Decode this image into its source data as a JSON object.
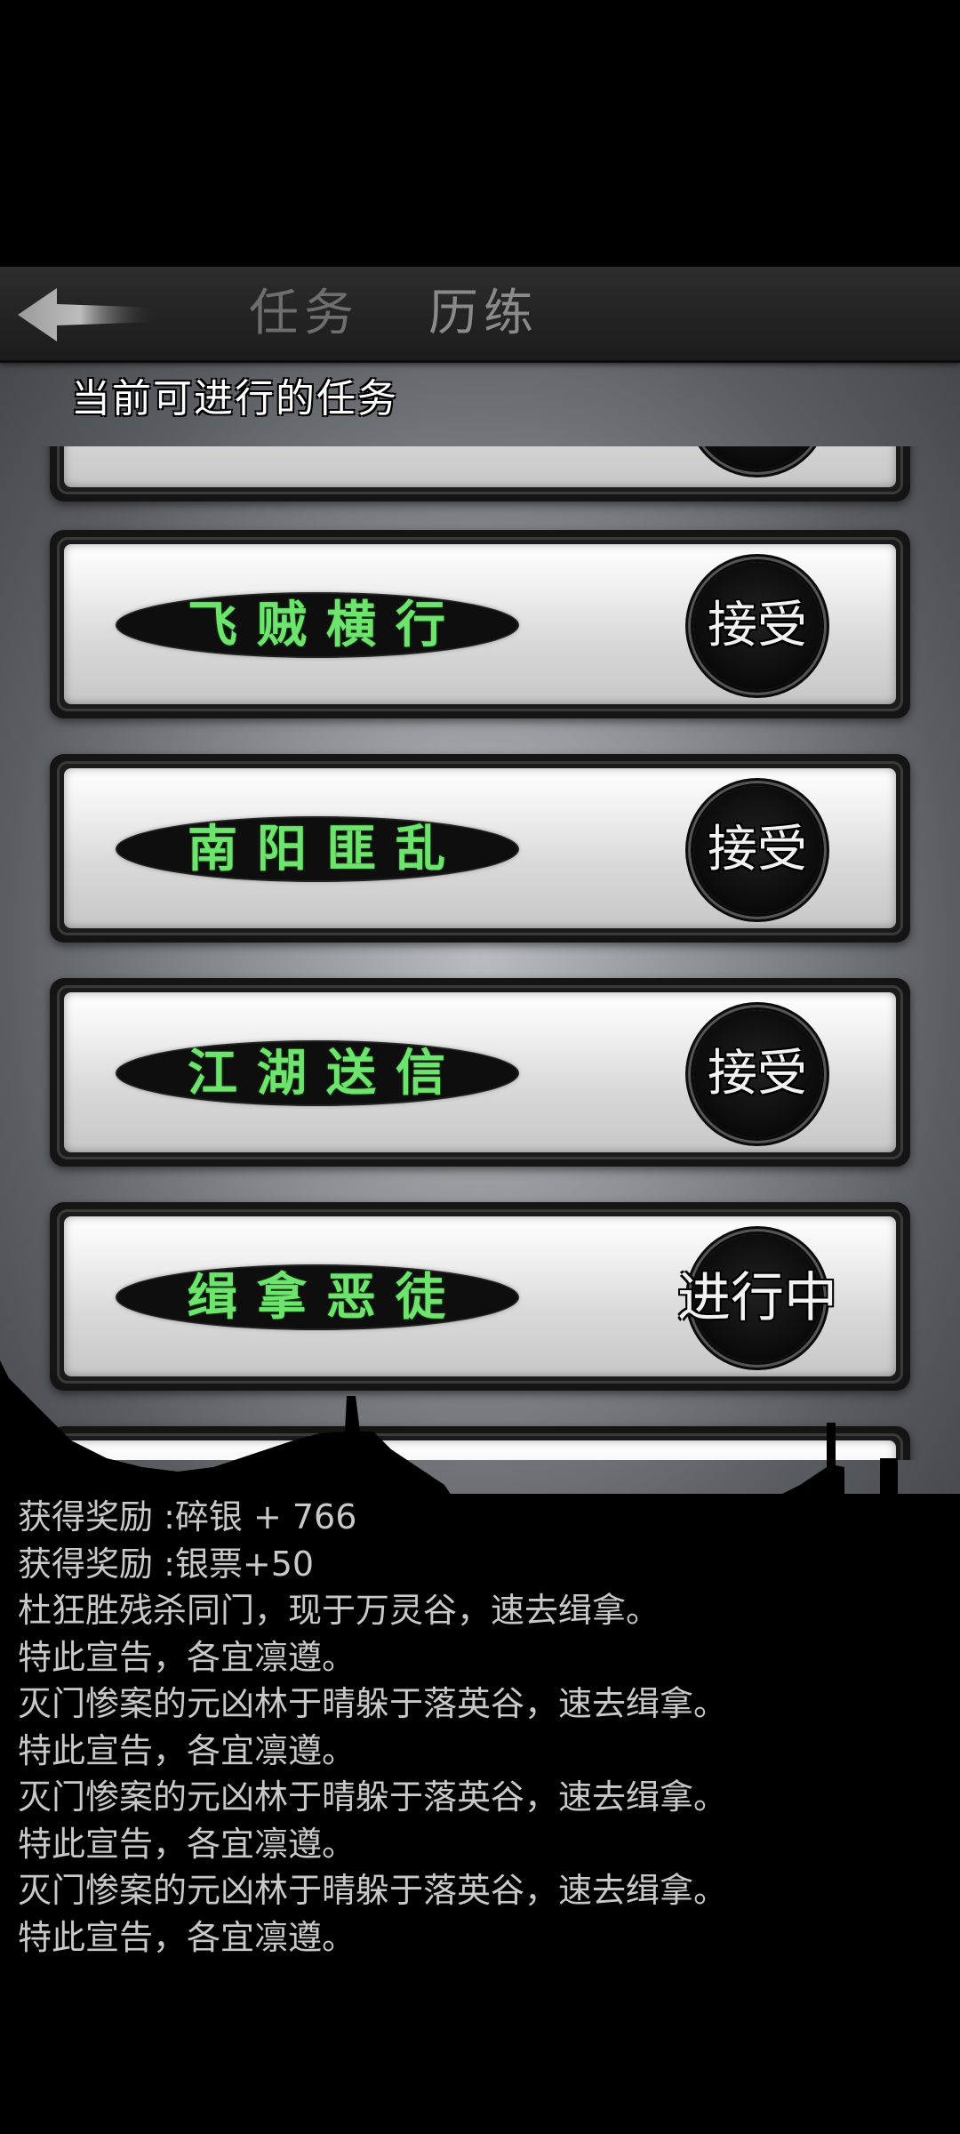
{
  "header": {
    "tabs": [
      {
        "label": "任务"
      },
      {
        "label": "历练"
      }
    ]
  },
  "section_title": "当前可进行的任务",
  "tasks": [
    {
      "name": "飞贼横行",
      "action": "接受"
    },
    {
      "name": "南阳匪乱",
      "action": "接受"
    },
    {
      "name": "江湖送信",
      "action": "接受"
    },
    {
      "name": "缉拿恶徒",
      "action": "进行中"
    }
  ],
  "log": [
    "获得奖励 :碎银 + 766",
    "获得奖励 :银票+50",
    "杜狂胜残杀同门，现于万灵谷，速去缉拿。",
    "特此宣告，各宜凛遵。",
    "灭门惨案的元凶林于晴躲于落英谷，速去缉拿。",
    "特此宣告，各宜凛遵。",
    "灭门惨案的元凶林于晴躲于落英谷，速去缉拿。",
    "特此宣告，各宜凛遵。",
    "灭门惨案的元凶林于晴躲于落英谷，速去缉拿。",
    "特此宣告，各宜凛遵。"
  ],
  "colors": {
    "task_name": "#6de56d",
    "header_bg": "#232323",
    "log_text": "#c9c9c9"
  }
}
